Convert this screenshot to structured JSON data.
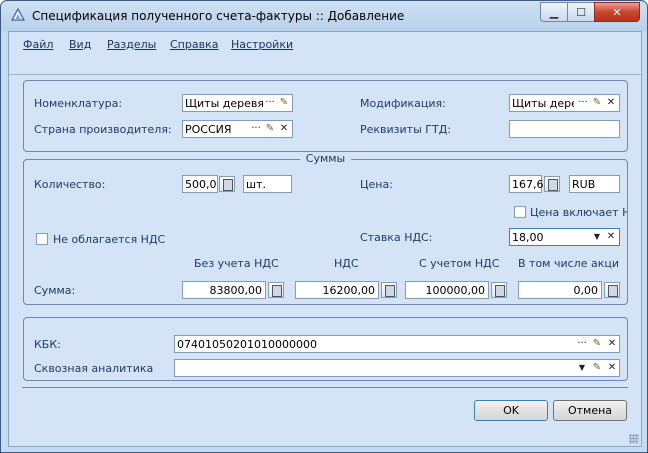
{
  "window": {
    "title": "Спецификация полученного счета-фактуры :: Добавление",
    "controls": {
      "minimize": "▁",
      "maximize": "☐",
      "close": "✕"
    }
  },
  "menu": [
    "Файл",
    "Вид",
    "Разделы",
    "Справка",
    "Настройки"
  ],
  "product": {
    "nomenclature_label": "Номенклатура:",
    "nomenclature_value": "Щиты деревя",
    "country_label": "Страна производителя:",
    "country_value": "РОССИЯ",
    "modification_label": "Модификация:",
    "modification_value": "Щиты дерев",
    "gtd_label": "Реквизиты ГТД:",
    "gtd_value": ""
  },
  "sums": {
    "group_title": "Суммы",
    "quantity_label": "Количество:",
    "quantity_value": "500,0",
    "unit_value": "шт.",
    "price_label": "Цена:",
    "price_value": "167,6",
    "currency_value": "RUB",
    "price_includes_vat_label": "Цена включает Н",
    "no_vat_label": "Не облагается НДС",
    "vat_rate_label": "Ставка НДС:",
    "vat_rate_value": "18,00",
    "col_headers": [
      "Без учета НДС",
      "НДС",
      "С учетом НДС",
      "В том числе акциз"
    ],
    "sum_label": "Сумма:",
    "sum_values": [
      "83800,00",
      "16200,00",
      "100000,00",
      "0,00"
    ]
  },
  "analytics": {
    "kbk_label": "КБК:",
    "kbk_value": "07401050201010000000",
    "through_label": "Сквозная аналитика",
    "through_value": ""
  },
  "buttons": {
    "ok": "OK",
    "cancel": "Отмена"
  },
  "icons": {
    "ellipsis": "···",
    "edit": "✎",
    "clear": "✕",
    "dropdown": "▼"
  }
}
